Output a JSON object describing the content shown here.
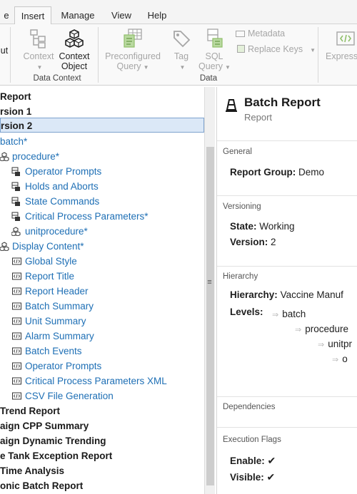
{
  "ribbon": {
    "tabs": [
      "e",
      "Insert",
      "Manage",
      "View",
      "Help"
    ],
    "left_cut_label": "ut",
    "buttons": {
      "context": {
        "line1": "Context",
        "line2": ""
      },
      "context_object": {
        "line1": "Context",
        "line2": "Object"
      },
      "preconfigured_query": {
        "line1": "Preconfigured",
        "line2": "Query"
      },
      "tag": {
        "line1": "Tag",
        "line2": ""
      },
      "sql_query": {
        "line1": "SQL",
        "line2": "Query"
      },
      "metadata": "Metadata",
      "replace_keys": "Replace Keys",
      "expression": "Expressi"
    },
    "groups": {
      "data_context": "Data Context",
      "data": "Data"
    }
  },
  "tree": {
    "rows": [
      {
        "text": " Report",
        "style": "bold"
      },
      {
        "text": "rsion 1",
        "style": "bold"
      },
      {
        "text": "rsion 2",
        "style": "bold-selected"
      },
      {
        "text": "batch*",
        "style": "link"
      },
      {
        "text": "procedure*",
        "style": "link"
      },
      {
        "text": "Operator Prompts",
        "style": "link"
      },
      {
        "text": "Holds and Aborts",
        "style": "link"
      },
      {
        "text": "State Commands",
        "style": "link"
      },
      {
        "text": "Critical Process Parameters*",
        "style": "link"
      },
      {
        "text": "unitprocedure*",
        "style": "link"
      },
      {
        "text": "Display Content*",
        "style": "link"
      },
      {
        "text": "Global Style",
        "style": "link"
      },
      {
        "text": "Report Title",
        "style": "link"
      },
      {
        "text": "Report Header",
        "style": "link"
      },
      {
        "text": "Batch Summary",
        "style": "link"
      },
      {
        "text": "Unit Summary",
        "style": "link"
      },
      {
        "text": "Alarm Summary",
        "style": "link"
      },
      {
        "text": "Batch Events",
        "style": "link"
      },
      {
        "text": "Operator Prompts",
        "style": "link"
      },
      {
        "text": "Critical Process Parameters XML",
        "style": "link"
      },
      {
        "text": "CSV File Generation",
        "style": "link"
      },
      {
        "text": " Trend Report",
        "style": "bold"
      },
      {
        "text": "aign CPP Summary",
        "style": "bold"
      },
      {
        "text": "aign Dynamic Trending",
        "style": "bold"
      },
      {
        "text": "e Tank Exception Report",
        "style": "bold"
      },
      {
        "text": "Time Analysis",
        "style": "bold"
      },
      {
        "text": "onic Batch Report",
        "style": "bold"
      }
    ]
  },
  "details": {
    "title": "Batch Report",
    "subtitle": "Report",
    "general": {
      "header": "General",
      "report_group_label": "Report Group:",
      "report_group_value": "Demo"
    },
    "versioning": {
      "header": "Versioning",
      "state_label": "State:",
      "state_value": "Working",
      "version_label": "Version:",
      "version_value": "2"
    },
    "hierarchy": {
      "header": "Hierarchy",
      "hierarchy_label": "Hierarchy:",
      "hierarchy_value": "Vaccine Manuf",
      "levels_label": "Levels:",
      "levels": [
        "batch",
        "procedure",
        "unitpr",
        "o"
      ]
    },
    "dependencies": {
      "header": "Dependencies"
    },
    "execution_flags": {
      "header": "Execution Flags",
      "enable_label": "Enable:",
      "visible_label": "Visible:"
    }
  },
  "colors": {
    "link": "#1e6fb5",
    "selection": "#dbe8f7",
    "selection_border": "#7da2ce",
    "accent_green": "#8fbf6a"
  }
}
